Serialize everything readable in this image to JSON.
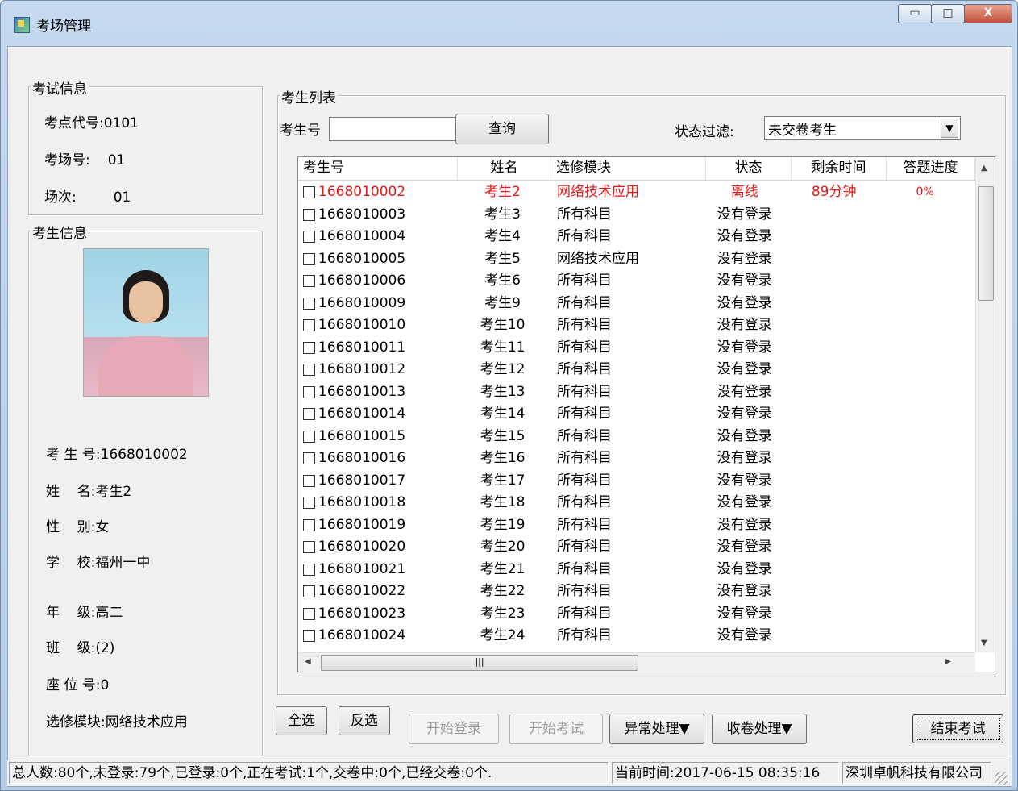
{
  "window": {
    "title": "考场管理",
    "controls": {
      "minimize": "▭",
      "maximize": "□",
      "close": "X"
    }
  },
  "exam_info": {
    "group_title": "考试信息",
    "site_code_label": "考点代号:",
    "site_code": "0101",
    "room_label": "考场号:",
    "room": "01",
    "session_label": "场次:",
    "session": "01"
  },
  "student_info": {
    "group_title": "考生信息",
    "rows": [
      {
        "label": "考 生 号:",
        "value": "1668010002"
      },
      {
        "label": "姓    名:",
        "value": "考生2"
      },
      {
        "label": "性    别:",
        "value": "女"
      },
      {
        "label": "学    校:",
        "value": "福州一中"
      },
      {
        "label": "年    级:",
        "value": "高二"
      },
      {
        "label": "班    级:",
        "value": "(2)"
      },
      {
        "label": "座 位 号:",
        "value": "0"
      },
      {
        "label": "选修模块:",
        "value": "网络技术应用"
      }
    ]
  },
  "list_group": {
    "title": "考生列表",
    "search_label": "考生号",
    "search_value": "",
    "query_button": "查询",
    "filter_label": "状态过滤:",
    "filter_value": "未交卷考生",
    "columns": [
      "考生号",
      "姓名",
      "选修模块",
      "状态",
      "剩余时间",
      "答题进度"
    ],
    "rows": [
      {
        "id": "1668010002",
        "name": "考生2",
        "module": "网络技术应用",
        "status": "离线",
        "remaining": "89分钟",
        "progress": "0%"
      },
      {
        "id": "1668010003",
        "name": "考生3",
        "module": "所有科目",
        "status": "没有登录",
        "remaining": "",
        "progress": ""
      },
      {
        "id": "1668010004",
        "name": "考生4",
        "module": "所有科目",
        "status": "没有登录",
        "remaining": "",
        "progress": ""
      },
      {
        "id": "1668010005",
        "name": "考生5",
        "module": "网络技术应用",
        "status": "没有登录",
        "remaining": "",
        "progress": ""
      },
      {
        "id": "1668010006",
        "name": "考生6",
        "module": "所有科目",
        "status": "没有登录",
        "remaining": "",
        "progress": ""
      },
      {
        "id": "1668010009",
        "name": "考生9",
        "module": "所有科目",
        "status": "没有登录",
        "remaining": "",
        "progress": ""
      },
      {
        "id": "1668010010",
        "name": "考生10",
        "module": "所有科目",
        "status": "没有登录",
        "remaining": "",
        "progress": ""
      },
      {
        "id": "1668010011",
        "name": "考生11",
        "module": "所有科目",
        "status": "没有登录",
        "remaining": "",
        "progress": ""
      },
      {
        "id": "1668010012",
        "name": "考生12",
        "module": "所有科目",
        "status": "没有登录",
        "remaining": "",
        "progress": ""
      },
      {
        "id": "1668010013",
        "name": "考生13",
        "module": "所有科目",
        "status": "没有登录",
        "remaining": "",
        "progress": ""
      },
      {
        "id": "1668010014",
        "name": "考生14",
        "module": "所有科目",
        "status": "没有登录",
        "remaining": "",
        "progress": ""
      },
      {
        "id": "1668010015",
        "name": "考生15",
        "module": "所有科目",
        "status": "没有登录",
        "remaining": "",
        "progress": ""
      },
      {
        "id": "1668010016",
        "name": "考生16",
        "module": "所有科目",
        "status": "没有登录",
        "remaining": "",
        "progress": ""
      },
      {
        "id": "1668010017",
        "name": "考生17",
        "module": "所有科目",
        "status": "没有登录",
        "remaining": "",
        "progress": ""
      },
      {
        "id": "1668010018",
        "name": "考生18",
        "module": "所有科目",
        "status": "没有登录",
        "remaining": "",
        "progress": ""
      },
      {
        "id": "1668010019",
        "name": "考生19",
        "module": "所有科目",
        "status": "没有登录",
        "remaining": "",
        "progress": ""
      },
      {
        "id": "1668010020",
        "name": "考生20",
        "module": "所有科目",
        "status": "没有登录",
        "remaining": "",
        "progress": ""
      },
      {
        "id": "1668010021",
        "name": "考生21",
        "module": "所有科目",
        "status": "没有登录",
        "remaining": "",
        "progress": ""
      },
      {
        "id": "1668010022",
        "name": "考生22",
        "module": "所有科目",
        "status": "没有登录",
        "remaining": "",
        "progress": ""
      },
      {
        "id": "1668010023",
        "name": "考生23",
        "module": "所有科目",
        "status": "没有登录",
        "remaining": "",
        "progress": ""
      },
      {
        "id": "1668010024",
        "name": "考生24",
        "module": "所有科目",
        "status": "没有登录",
        "remaining": "",
        "progress": ""
      }
    ],
    "highlight_color": "#e81818"
  },
  "buttons": {
    "select_all": "全选",
    "invert": "反选",
    "start_login": "开始登录",
    "start_exam": "开始考试",
    "exception": "异常处理▼",
    "collect": "收卷处理▼",
    "end_exam": "结束考试"
  },
  "status_bar": {
    "summary": "总人数:80个,未登录:79个,已登录:0个,正在考试:1个,交卷中:0个,已经交卷:0个.",
    "time": "当前时间:2017-06-15 08:35:16",
    "company": "深圳卓帆科技有限公司"
  }
}
